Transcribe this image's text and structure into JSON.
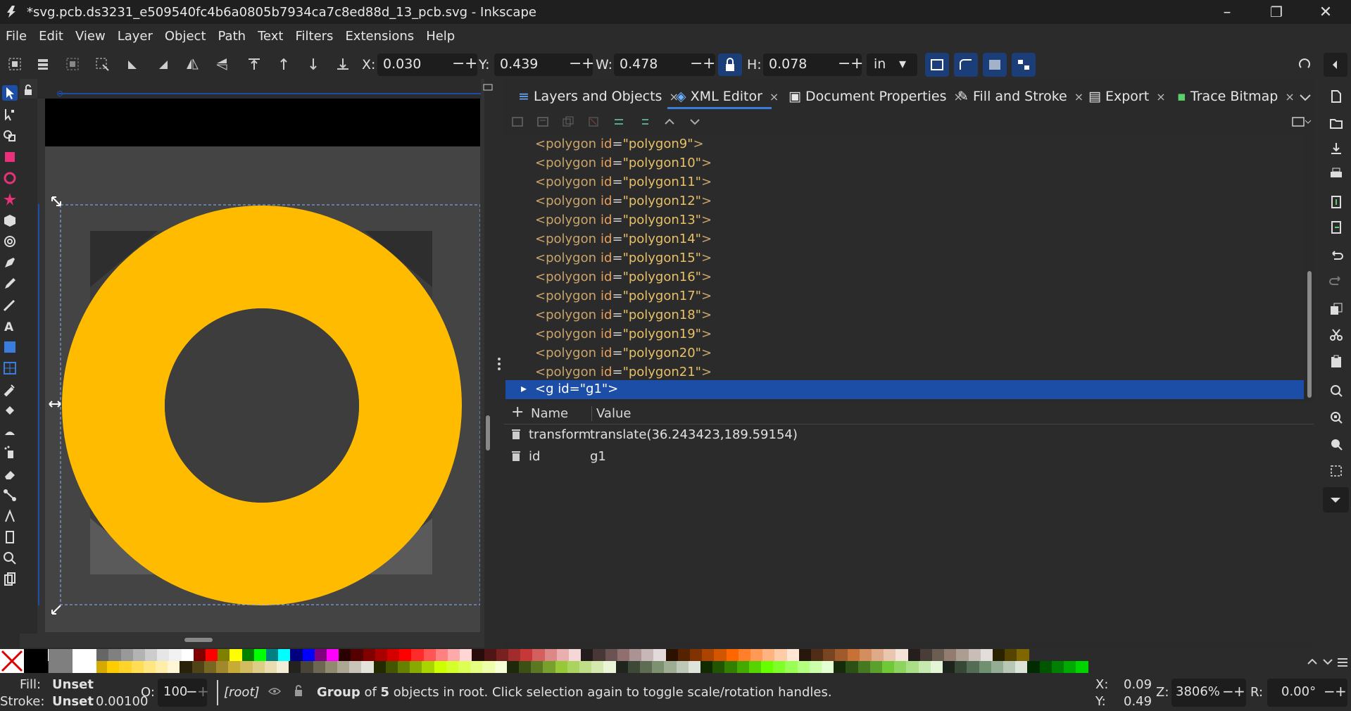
{
  "window": {
    "title": "*svg.pcb.ds3231_e509540fc4b6a0805b7934ca7c8ed88d_13_pcb.svg - Inkscape",
    "minimize": "–",
    "restore": "❐",
    "close": "✕"
  },
  "menu": [
    "File",
    "Edit",
    "View",
    "Layer",
    "Object",
    "Path",
    "Text",
    "Filters",
    "Extensions",
    "Help"
  ],
  "toolbar": {
    "x_label": "X:",
    "x_value": "0.030",
    "y_label": "Y:",
    "y_value": "0.439",
    "w_label": "W:",
    "w_value": "0.478",
    "h_label": "H:",
    "h_value": "0.078",
    "minus": "−",
    "plus": "+",
    "unit": "in",
    "unit_arrow": "▾"
  },
  "tabs": [
    {
      "label": "Layers and Objects",
      "close": "×"
    },
    {
      "label": "XML Editor",
      "close": "×"
    },
    {
      "label": "Document Properties",
      "close": "×"
    },
    {
      "label": "Fill and Stroke",
      "close": "×"
    },
    {
      "label": "Export",
      "close": "×"
    },
    {
      "label": "Trace Bitmap",
      "close": "×"
    }
  ],
  "xml_nodes": [
    {
      "tag": "<polygon",
      "attr": "id",
      "eq": "=",
      "val": "\"polygon9\"",
      "end": ">"
    },
    {
      "tag": "<polygon",
      "attr": "id",
      "eq": "=",
      "val": "\"polygon10\"",
      "end": ">"
    },
    {
      "tag": "<polygon",
      "attr": "id",
      "eq": "=",
      "val": "\"polygon11\"",
      "end": ">"
    },
    {
      "tag": "<polygon",
      "attr": "id",
      "eq": "=",
      "val": "\"polygon12\"",
      "end": ">"
    },
    {
      "tag": "<polygon",
      "attr": "id",
      "eq": "=",
      "val": "\"polygon13\"",
      "end": ">"
    },
    {
      "tag": "<polygon",
      "attr": "id",
      "eq": "=",
      "val": "\"polygon14\"",
      "end": ">"
    },
    {
      "tag": "<polygon",
      "attr": "id",
      "eq": "=",
      "val": "\"polygon15\"",
      "end": ">"
    },
    {
      "tag": "<polygon",
      "attr": "id",
      "eq": "=",
      "val": "\"polygon16\"",
      "end": ">"
    },
    {
      "tag": "<polygon",
      "attr": "id",
      "eq": "=",
      "val": "\"polygon17\"",
      "end": ">"
    },
    {
      "tag": "<polygon",
      "attr": "id",
      "eq": "=",
      "val": "\"polygon18\"",
      "end": ">"
    },
    {
      "tag": "<polygon",
      "attr": "id",
      "eq": "=",
      "val": "\"polygon19\"",
      "end": ">"
    },
    {
      "tag": "<polygon",
      "attr": "id",
      "eq": "=",
      "val": "\"polygon20\"",
      "end": ">"
    },
    {
      "tag": "<polygon",
      "attr": "id",
      "eq": "=",
      "val": "\"polygon21\"",
      "end": ">"
    }
  ],
  "selected_node": {
    "expander": "▸",
    "text": "<g id=\"g1\">"
  },
  "attributes": {
    "add": "+",
    "name_header": "Name",
    "value_header": "Value",
    "rows": [
      {
        "name": "transform",
        "value": "translate(36.243423,189.59154)"
      },
      {
        "name": "id",
        "value": "g1"
      }
    ]
  },
  "status": {
    "fill_label": "Fill:",
    "fill_value": "Unset",
    "stroke_label": "Stroke:",
    "stroke_value": "Unset",
    "stroke_width": "0.00100",
    "opacity_label": "O:",
    "opacity_value": "100",
    "layer": "[root]",
    "message_bold": "Group",
    "message_rest": " of ",
    "message_count": "5",
    "message_tail": " objects in root. Click selection again to toggle scale/rotation handles.",
    "cursor_x_label": "X:",
    "cursor_x": "0.09",
    "cursor_y_label": "Y:",
    "cursor_y": "0.49",
    "zoom_label": "Z:",
    "zoom_value": "3806%",
    "rotation_label": "R:",
    "rotation_value": "0.00°"
  },
  "colors": {
    "donut": "#FFBB00",
    "selection_blue": "#1C4EA7",
    "accent": "#3B7DDD"
  },
  "palette_top": [
    "#000000",
    "#7f7f7f",
    "#ffffff",
    "#1a1a1a",
    "#333333",
    "#4d4d4d",
    "#666666",
    "#808080",
    "#999999",
    "#b3b3b3",
    "#cccccc",
    "#e6e6e6",
    "#f2f2f2",
    "#ffffff",
    "#800000",
    "#ff0000",
    "#808000",
    "#ffff00",
    "#008000",
    "#00ff00",
    "#008080",
    "#00ffff",
    "#000080",
    "#0000ff",
    "#800080",
    "#ff00ff",
    "#2b0000",
    "#550000",
    "#800000",
    "#aa0000",
    "#d40000",
    "#ff0000",
    "#ff2a2a",
    "#ff5555",
    "#ff8080",
    "#ffaaaa",
    "#ffd5d5",
    "#280b0b",
    "#501616",
    "#782121",
    "#a02c2c",
    "#c83737",
    "#d35f5f",
    "#de8787",
    "#e9afaf",
    "#f4d7d7",
    "#241c1c",
    "#483737",
    "#6c5353",
    "#916f6f",
    "#ac9393",
    "#c8b7b7",
    "#e3dbdb",
    "#2b1100",
    "#552200",
    "#803300",
    "#aa4400",
    "#d45500",
    "#ff6600",
    "#ff7f2a",
    "#ff9955",
    "#ffb380",
    "#ffccaa",
    "#ffe6d5",
    "#28170b",
    "#502d16",
    "#784421",
    "#a05a2c",
    "#c87137",
    "#d38d5f",
    "#deaa87",
    "#e9c6af",
    "#f4e3d7",
    "#241f1c",
    "#483e37",
    "#6c5d53",
    "#917c6f",
    "#ac9d93",
    "#c8beb7",
    "#e3dedb",
    "#2b2200",
    "#554400",
    "#806600"
  ],
  "palette_bottom": [
    "#d4aa00",
    "#ffcc00",
    "#ffd42a",
    "#ffdd55",
    "#ffe680",
    "#ffeeaa",
    "#fff6d5",
    "#28220b",
    "#504416",
    "#786721",
    "#a0892c",
    "#c8ab37",
    "#d3bc5f",
    "#decd87",
    "#e9ddaf",
    "#f4eed7",
    "#24221c",
    "#484537",
    "#6c6753",
    "#918a6f",
    "#aca793",
    "#c8c4b7",
    "#e3e2db",
    "#222b00",
    "#445500",
    "#668000",
    "#88aa00",
    "#aad400",
    "#ccff00",
    "#d4ff2a",
    "#ddff55",
    "#e5ff80",
    "#eeffaa",
    "#f6ffd5",
    "#1e280b",
    "#3c5016",
    "#5a7821",
    "#78a02c",
    "#96c837",
    "#abd35f",
    "#c0de87",
    "#d5e9af",
    "#eaf4d7",
    "#1f241c",
    "#3e4837",
    "#5d6c53",
    "#7c916f",
    "#9dac93",
    "#bec8b7",
    "#dee3db",
    "#112b00",
    "#225500",
    "#338000",
    "#44aa00",
    "#55d400",
    "#66ff00",
    "#7fff2a",
    "#99ff55",
    "#b3ff80",
    "#ccffaa",
    "#e5ffd5",
    "#162b0b",
    "#2d5016",
    "#447821",
    "#5aa02c",
    "#71c837",
    "#8dd35f",
    "#aade87",
    "#c6e9af",
    "#e3f4d7",
    "#1c241c",
    "#374837",
    "#536c53",
    "#6f916f",
    "#93ac93",
    "#b7c8b7",
    "#dbe3db",
    "#002b00",
    "#005500",
    "#008000",
    "#00aa00",
    "#00d400"
  ]
}
